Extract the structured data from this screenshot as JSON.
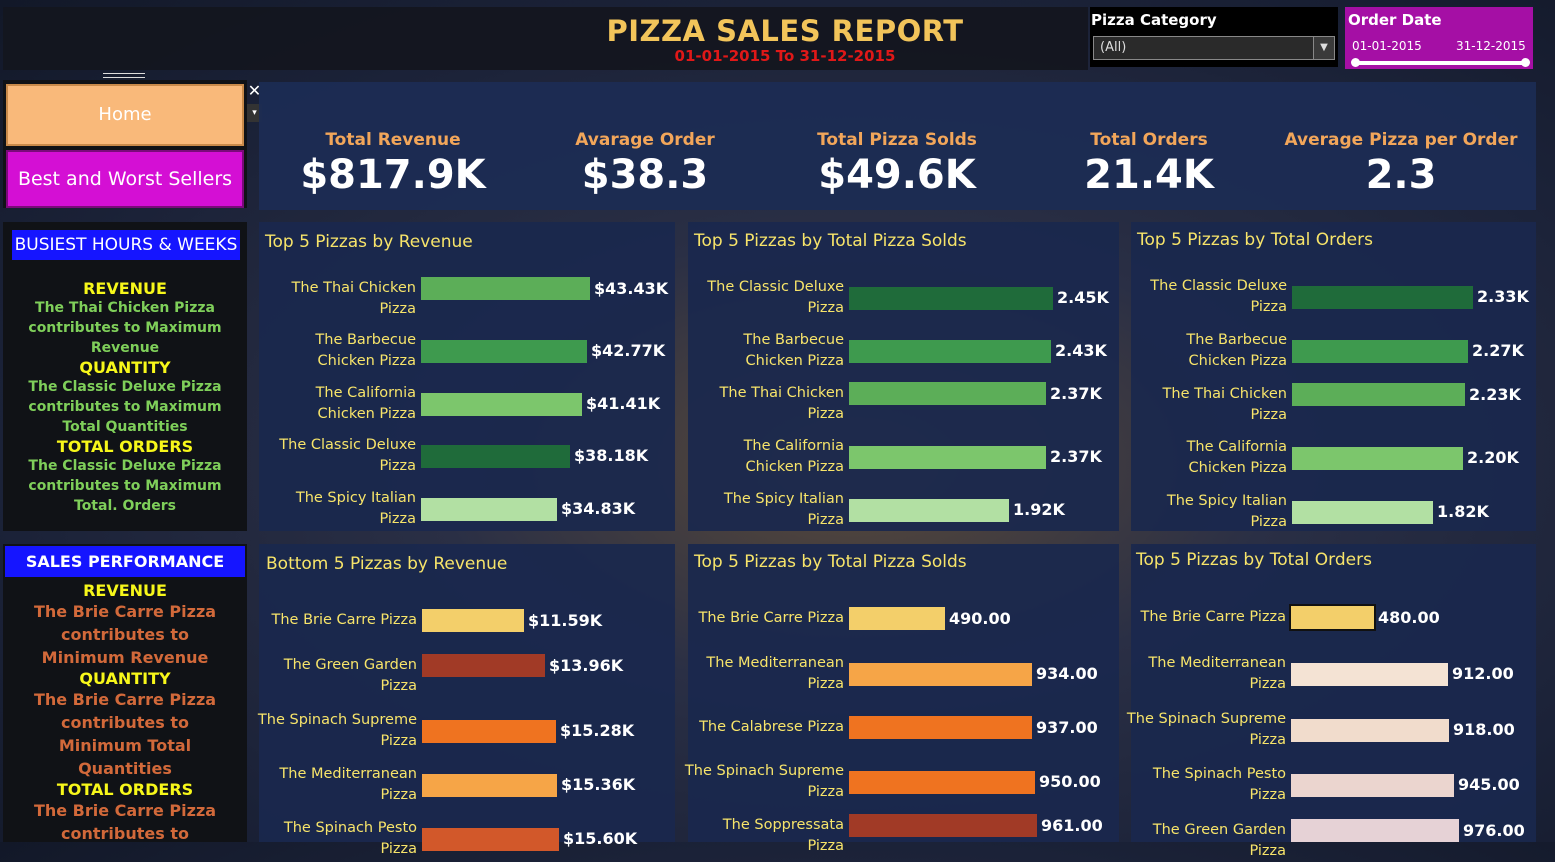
{
  "header": {
    "title": "PIZZA SALES REPORT",
    "subtitle": "01-01-2015 To 31-12-2015"
  },
  "filters": {
    "category_label": "Pizza Category",
    "category_value": "(All)",
    "date_label": "Order Date",
    "date_start": "01-01-2015",
    "date_end": "31-12-2015"
  },
  "nav": {
    "home": "Home",
    "best_worst": "Best and Worst Sellers",
    "close": "✕",
    "drop": "▾"
  },
  "kpis": [
    {
      "label": "Total Revenue",
      "value": "$817.9K"
    },
    {
      "label": "Avarage Order",
      "value": "$38.3"
    },
    {
      "label": "Total Pizza Solds",
      "value": "$49.6K"
    },
    {
      "label": "Total Orders",
      "value": "21.4K"
    },
    {
      "label": "Average Pizza per Order",
      "value": "2.3"
    }
  ],
  "busiest": {
    "title": "BUSIEST HOURS & WEEKS",
    "revenue_h": "REVENUE",
    "revenue_t": "The Thai Chicken Pizza contributes to Maximum Revenue",
    "quantity_h": "QUANTITY",
    "quantity_t": "The Classic Deluxe Pizza contributes to Maximum Total Quantities",
    "orders_h": "TOTAL ORDERS",
    "orders_t": "The Classic Deluxe Pizza contributes to Maximum Total. Orders"
  },
  "performance": {
    "title": "SALES PERFORMANCE",
    "revenue_h": "REVENUE",
    "revenue_t": "The Brie Carre Pizza contributes to Minimum Revenue",
    "quantity_h": "QUANTITY",
    "quantity_t": "The Brie Carre Pizza contributes to Minimum Total Quantities",
    "orders_h": "TOTAL ORDERS",
    "orders_t": "The Brie Carre Pizza contributes to Minimum Total Orders"
  },
  "colors": {
    "green_dark": "#1f6b3a",
    "green_mid": "#3e9a4e",
    "green_med": "#5cae58",
    "green_light": "#7cc66c",
    "green_pale": "#b2e0a3",
    "yellow": "#f3cf6a",
    "rust": "#a13a26",
    "orange": "#ef7320",
    "orange_light": "#f6a547",
    "peach": "#f4e3d4"
  },
  "chart_data": [
    {
      "type": "bar",
      "title": "Top 5 Pizzas by Revenue",
      "categories": [
        "The Thai Chicken Pizza",
        "The Barbecue Chicken Pizza",
        "The California Chicken Pizza",
        "The Classic Deluxe Pizza",
        "The Spicy Italian Pizza"
      ],
      "values": [
        43.43,
        42.77,
        41.41,
        38.18,
        34.83
      ],
      "labels": [
        "$43.43K",
        "$42.77K",
        "$41.41K",
        "$38.18K",
        "$34.83K"
      ],
      "colors": [
        "#5cae58",
        "#3e9a4e",
        "#7cc66c",
        "#1f6b3a",
        "#b2e0a3"
      ]
    },
    {
      "type": "bar",
      "title": "Top 5 Pizzas by Total Pizza Solds",
      "categories": [
        "The Classic Deluxe Pizza",
        "The Barbecue Chicken Pizza",
        "The Thai Chicken Pizza",
        "The California Chicken Pizza",
        "The Spicy Italian Pizza"
      ],
      "values": [
        2.45,
        2.43,
        2.37,
        2.37,
        1.92
      ],
      "labels": [
        "2.45K",
        "2.43K",
        "2.37K",
        "2.37K",
        "1.92K"
      ],
      "colors": [
        "#1f6b3a",
        "#3e9a4e",
        "#5cae58",
        "#7cc66c",
        "#b2e0a3"
      ]
    },
    {
      "type": "bar",
      "title": "Top 5 Pizzas by Total Orders",
      "categories": [
        "The Classic Deluxe Pizza",
        "The Barbecue Chicken Pizza",
        "The Thai Chicken Pizza",
        "The California Chicken Pizza",
        "The Spicy Italian Pizza"
      ],
      "values": [
        2.33,
        2.27,
        2.23,
        2.2,
        1.82
      ],
      "labels": [
        "2.33K",
        "2.27K",
        "2.23K",
        "2.20K",
        "1.82K"
      ],
      "colors": [
        "#1f6b3a",
        "#3e9a4e",
        "#5cae58",
        "#7cc66c",
        "#b2e0a3"
      ]
    },
    {
      "type": "bar",
      "title": "Bottom 5 Pizzas by Revenue",
      "categories": [
        "The Brie Carre Pizza",
        "The Green Garden Pizza",
        "The Spinach Supreme Pizza",
        "The Mediterranean Pizza",
        "The Spinach Pesto Pizza"
      ],
      "values": [
        11.59,
        13.96,
        15.28,
        15.36,
        15.6
      ],
      "labels": [
        "$11.59K",
        "$13.96K",
        "$15.28K",
        "$15.36K",
        "$15.60K"
      ],
      "colors": [
        "#f3cf6a",
        "#a13a26",
        "#ef7320",
        "#f6a547",
        "#d2582a"
      ]
    },
    {
      "type": "bar",
      "title": "Top 5 Pizzas by Total Pizza Solds",
      "categories": [
        "The Brie Carre Pizza",
        "The Mediterranean Pizza",
        "The Calabrese Pizza",
        "The Spinach Supreme Pizza",
        "The Soppressata Pizza"
      ],
      "values": [
        490,
        934,
        937,
        950,
        961
      ],
      "labels": [
        "490.00",
        "934.00",
        "937.00",
        "950.00",
        "961.00"
      ],
      "colors": [
        "#f3cf6a",
        "#f6a547",
        "#ef7320",
        "#ef7320",
        "#a13a26"
      ]
    },
    {
      "type": "bar",
      "title": "Top 5 Pizzas by Total Orders",
      "categories": [
        "The Brie Carre Pizza",
        "The Mediterranean Pizza",
        "The Spinach Supreme Pizza",
        "The Spinach Pesto Pizza",
        "The Green Garden Pizza"
      ],
      "values": [
        480,
        912,
        918,
        945,
        976
      ],
      "labels": [
        "480.00",
        "912.00",
        "918.00",
        "945.00",
        "976.00"
      ],
      "colors": [
        "#f3cf6a",
        "#f4e3d4",
        "#f1dccc",
        "#ebd5cf",
        "#e6d2d6"
      ]
    }
  ]
}
